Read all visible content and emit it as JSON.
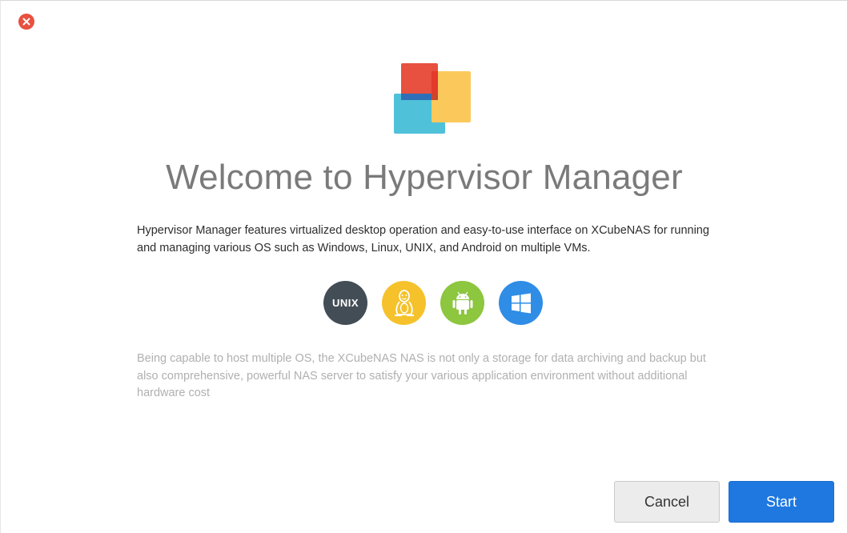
{
  "dialog": {
    "title": "Welcome to Hypervisor Manager",
    "description": "Hypervisor Manager features virtualized desktop operation and easy-to-use interface on XCubeNAS for running and managing various OS such as Windows, Linux, UNIX, and Android on multiple VMs.",
    "sub_description": "Being capable to host multiple OS, the XCubeNAS NAS is not only a storage for data archiving and backup but also comprehensive, powerful NAS server to satisfy your various application environment without additional hardware cost",
    "os_icons": [
      {
        "name": "unix-icon",
        "label": "UNIX",
        "color": "#434d56"
      },
      {
        "name": "linux-icon",
        "color": "#f5c22b"
      },
      {
        "name": "android-icon",
        "color": "#8dc63f"
      },
      {
        "name": "windows-icon",
        "color": "#2f8de6"
      }
    ],
    "buttons": {
      "cancel_label": "Cancel",
      "start_label": "Start"
    },
    "colors": {
      "close": "#e8503f",
      "primary": "#1e78e0",
      "logo_red": "#e8503f",
      "logo_cyan": "#4fc1d9",
      "logo_yellow": "#fbc95b"
    }
  }
}
